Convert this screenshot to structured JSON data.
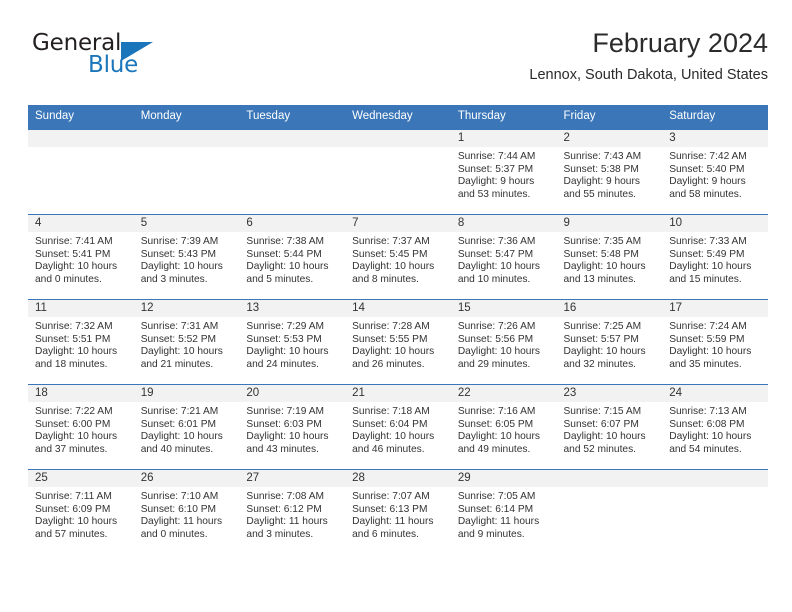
{
  "logo": {
    "word_top": "General",
    "word_bottom": "Blue",
    "accent_color": "#1b75bb",
    "triangle_icon": "triangle-icon"
  },
  "header": {
    "title": "February 2024",
    "subtitle": "Lennox, South Dakota, United States"
  },
  "theme": {
    "header_blue": "#3a76b8",
    "daynum_band": "#f2f2f2",
    "text": "#333333"
  },
  "weekdays": [
    "Sunday",
    "Monday",
    "Tuesday",
    "Wednesday",
    "Thursday",
    "Friday",
    "Saturday"
  ],
  "labels": {
    "sunrise_prefix": "Sunrise:",
    "sunset_prefix": "Sunset:",
    "daylight_prefix": "Daylight:"
  },
  "weeks": [
    [
      {
        "day": "",
        "empty": true
      },
      {
        "day": "",
        "empty": true
      },
      {
        "day": "",
        "empty": true
      },
      {
        "day": "",
        "empty": true
      },
      {
        "day": "1",
        "sunrise": "Sunrise: 7:44 AM",
        "sunset": "Sunset: 5:37 PM",
        "daylight1": "Daylight: 9 hours",
        "daylight2": "and 53 minutes."
      },
      {
        "day": "2",
        "sunrise": "Sunrise: 7:43 AM",
        "sunset": "Sunset: 5:38 PM",
        "daylight1": "Daylight: 9 hours",
        "daylight2": "and 55 minutes."
      },
      {
        "day": "3",
        "sunrise": "Sunrise: 7:42 AM",
        "sunset": "Sunset: 5:40 PM",
        "daylight1": "Daylight: 9 hours",
        "daylight2": "and 58 minutes."
      }
    ],
    [
      {
        "day": "4",
        "sunrise": "Sunrise: 7:41 AM",
        "sunset": "Sunset: 5:41 PM",
        "daylight1": "Daylight: 10 hours",
        "daylight2": "and 0 minutes."
      },
      {
        "day": "5",
        "sunrise": "Sunrise: 7:39 AM",
        "sunset": "Sunset: 5:43 PM",
        "daylight1": "Daylight: 10 hours",
        "daylight2": "and 3 minutes."
      },
      {
        "day": "6",
        "sunrise": "Sunrise: 7:38 AM",
        "sunset": "Sunset: 5:44 PM",
        "daylight1": "Daylight: 10 hours",
        "daylight2": "and 5 minutes."
      },
      {
        "day": "7",
        "sunrise": "Sunrise: 7:37 AM",
        "sunset": "Sunset: 5:45 PM",
        "daylight1": "Daylight: 10 hours",
        "daylight2": "and 8 minutes."
      },
      {
        "day": "8",
        "sunrise": "Sunrise: 7:36 AM",
        "sunset": "Sunset: 5:47 PM",
        "daylight1": "Daylight: 10 hours",
        "daylight2": "and 10 minutes."
      },
      {
        "day": "9",
        "sunrise": "Sunrise: 7:35 AM",
        "sunset": "Sunset: 5:48 PM",
        "daylight1": "Daylight: 10 hours",
        "daylight2": "and 13 minutes."
      },
      {
        "day": "10",
        "sunrise": "Sunrise: 7:33 AM",
        "sunset": "Sunset: 5:49 PM",
        "daylight1": "Daylight: 10 hours",
        "daylight2": "and 15 minutes."
      }
    ],
    [
      {
        "day": "11",
        "sunrise": "Sunrise: 7:32 AM",
        "sunset": "Sunset: 5:51 PM",
        "daylight1": "Daylight: 10 hours",
        "daylight2": "and 18 minutes."
      },
      {
        "day": "12",
        "sunrise": "Sunrise: 7:31 AM",
        "sunset": "Sunset: 5:52 PM",
        "daylight1": "Daylight: 10 hours",
        "daylight2": "and 21 minutes."
      },
      {
        "day": "13",
        "sunrise": "Sunrise: 7:29 AM",
        "sunset": "Sunset: 5:53 PM",
        "daylight1": "Daylight: 10 hours",
        "daylight2": "and 24 minutes."
      },
      {
        "day": "14",
        "sunrise": "Sunrise: 7:28 AM",
        "sunset": "Sunset: 5:55 PM",
        "daylight1": "Daylight: 10 hours",
        "daylight2": "and 26 minutes."
      },
      {
        "day": "15",
        "sunrise": "Sunrise: 7:26 AM",
        "sunset": "Sunset: 5:56 PM",
        "daylight1": "Daylight: 10 hours",
        "daylight2": "and 29 minutes."
      },
      {
        "day": "16",
        "sunrise": "Sunrise: 7:25 AM",
        "sunset": "Sunset: 5:57 PM",
        "daylight1": "Daylight: 10 hours",
        "daylight2": "and 32 minutes."
      },
      {
        "day": "17",
        "sunrise": "Sunrise: 7:24 AM",
        "sunset": "Sunset: 5:59 PM",
        "daylight1": "Daylight: 10 hours",
        "daylight2": "and 35 minutes."
      }
    ],
    [
      {
        "day": "18",
        "sunrise": "Sunrise: 7:22 AM",
        "sunset": "Sunset: 6:00 PM",
        "daylight1": "Daylight: 10 hours",
        "daylight2": "and 37 minutes."
      },
      {
        "day": "19",
        "sunrise": "Sunrise: 7:21 AM",
        "sunset": "Sunset: 6:01 PM",
        "daylight1": "Daylight: 10 hours",
        "daylight2": "and 40 minutes."
      },
      {
        "day": "20",
        "sunrise": "Sunrise: 7:19 AM",
        "sunset": "Sunset: 6:03 PM",
        "daylight1": "Daylight: 10 hours",
        "daylight2": "and 43 minutes."
      },
      {
        "day": "21",
        "sunrise": "Sunrise: 7:18 AM",
        "sunset": "Sunset: 6:04 PM",
        "daylight1": "Daylight: 10 hours",
        "daylight2": "and 46 minutes."
      },
      {
        "day": "22",
        "sunrise": "Sunrise: 7:16 AM",
        "sunset": "Sunset: 6:05 PM",
        "daylight1": "Daylight: 10 hours",
        "daylight2": "and 49 minutes."
      },
      {
        "day": "23",
        "sunrise": "Sunrise: 7:15 AM",
        "sunset": "Sunset: 6:07 PM",
        "daylight1": "Daylight: 10 hours",
        "daylight2": "and 52 minutes."
      },
      {
        "day": "24",
        "sunrise": "Sunrise: 7:13 AM",
        "sunset": "Sunset: 6:08 PM",
        "daylight1": "Daylight: 10 hours",
        "daylight2": "and 54 minutes."
      }
    ],
    [
      {
        "day": "25",
        "sunrise": "Sunrise: 7:11 AM",
        "sunset": "Sunset: 6:09 PM",
        "daylight1": "Daylight: 10 hours",
        "daylight2": "and 57 minutes."
      },
      {
        "day": "26",
        "sunrise": "Sunrise: 7:10 AM",
        "sunset": "Sunset: 6:10 PM",
        "daylight1": "Daylight: 11 hours",
        "daylight2": "and 0 minutes."
      },
      {
        "day": "27",
        "sunrise": "Sunrise: 7:08 AM",
        "sunset": "Sunset: 6:12 PM",
        "daylight1": "Daylight: 11 hours",
        "daylight2": "and 3 minutes."
      },
      {
        "day": "28",
        "sunrise": "Sunrise: 7:07 AM",
        "sunset": "Sunset: 6:13 PM",
        "daylight1": "Daylight: 11 hours",
        "daylight2": "and 6 minutes."
      },
      {
        "day": "29",
        "sunrise": "Sunrise: 7:05 AM",
        "sunset": "Sunset: 6:14 PM",
        "daylight1": "Daylight: 11 hours",
        "daylight2": "and 9 minutes."
      },
      {
        "day": "",
        "empty": true
      },
      {
        "day": "",
        "empty": true
      }
    ]
  ]
}
